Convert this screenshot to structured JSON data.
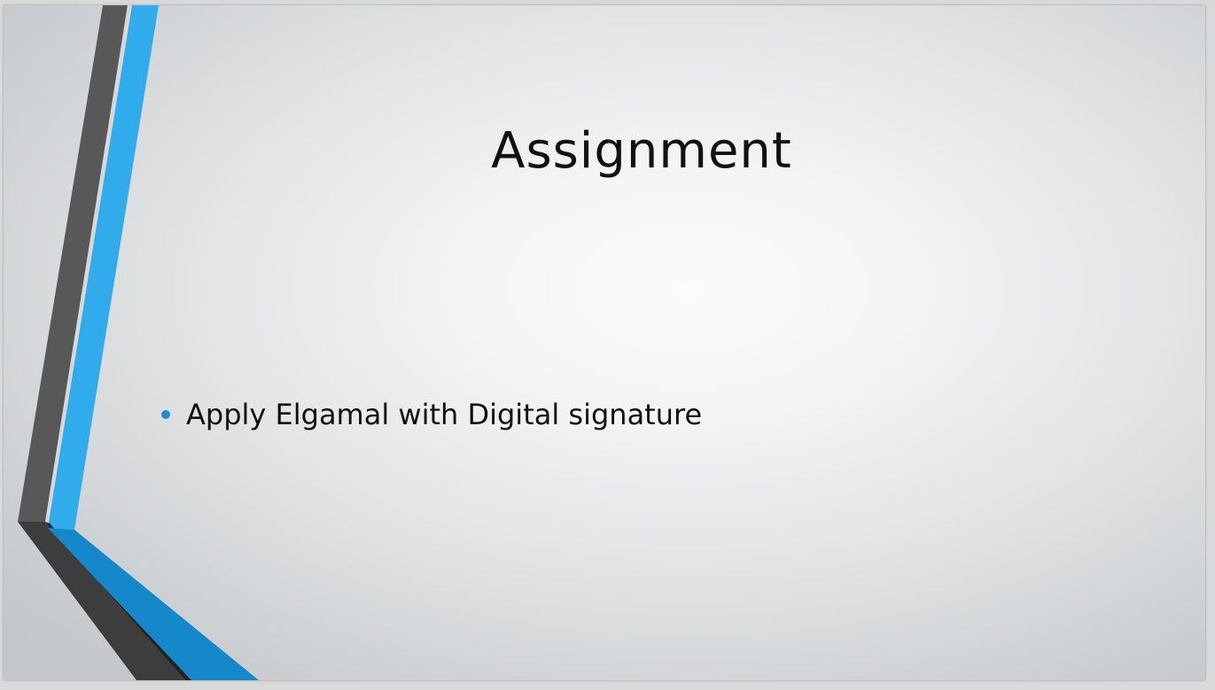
{
  "slide": {
    "title": "Assignment",
    "bullets": [
      "Apply Elgamal with Digital signature"
    ]
  },
  "colors": {
    "accent_blue": "#2eaaec",
    "accent_blue_dark": "#1685c8",
    "dark_gray": "#595959",
    "darker_gray": "#333333",
    "bullet": "#1a8fd6"
  }
}
